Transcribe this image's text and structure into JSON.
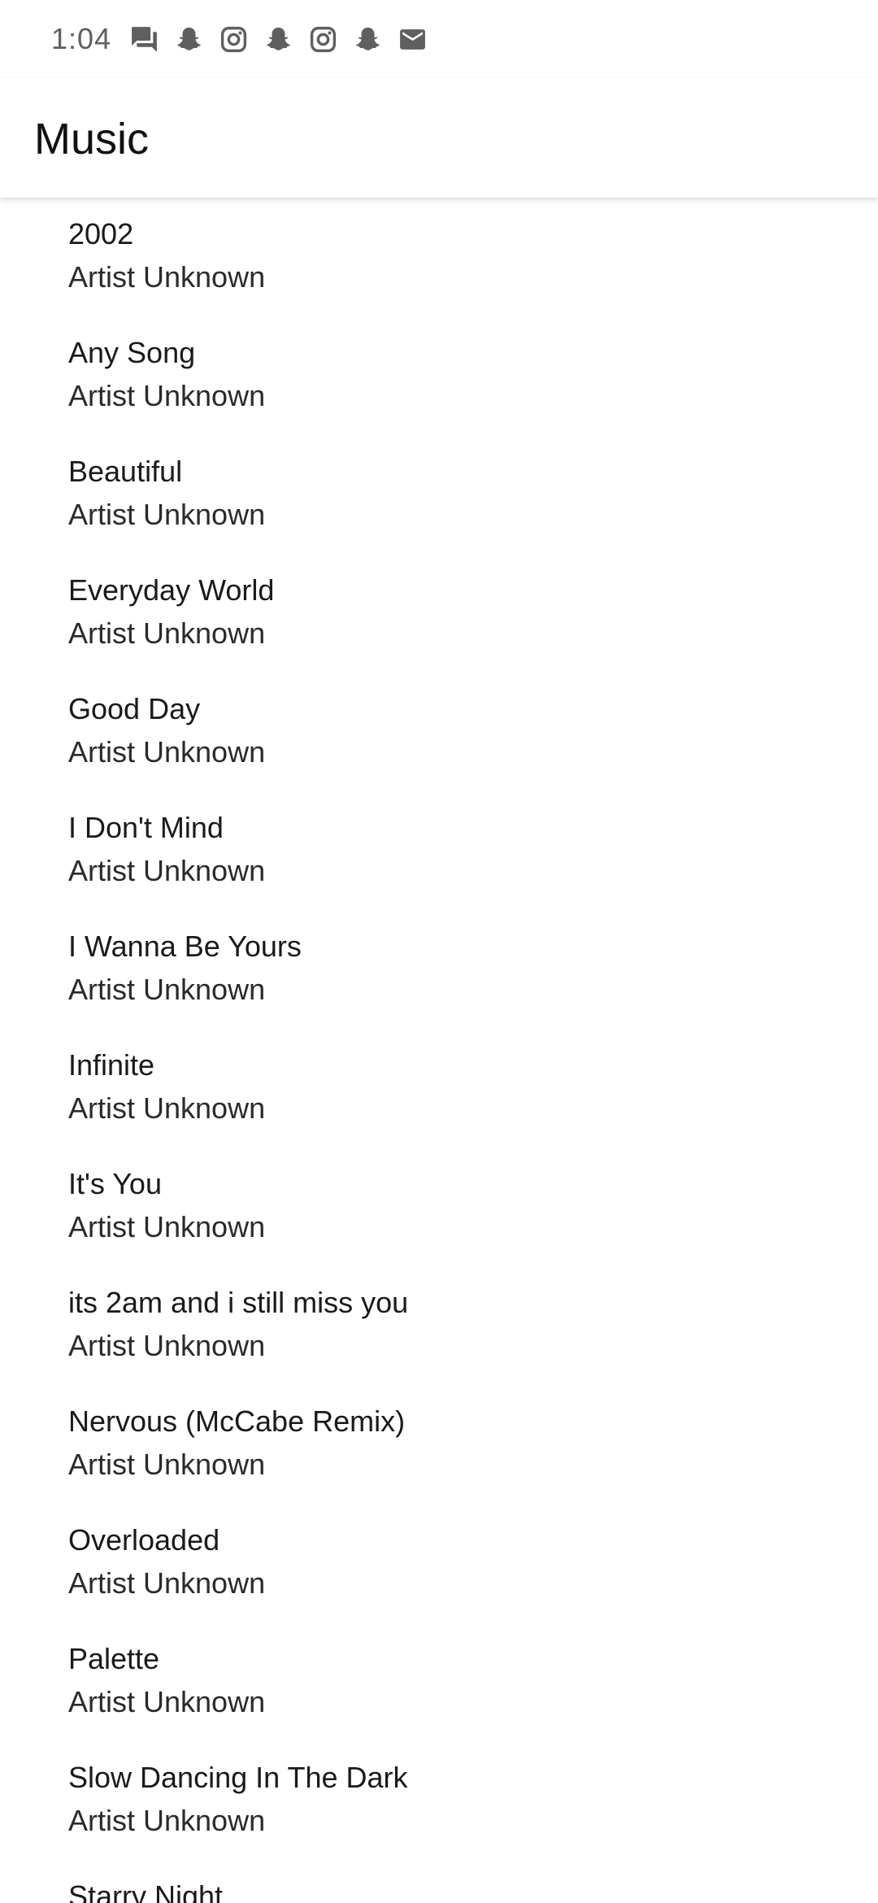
{
  "status_bar": {
    "time": "1:04",
    "icons": [
      "chat-icon",
      "snapchat-icon",
      "instagram-icon",
      "snapchat-icon",
      "instagram-icon",
      "snapchat-icon",
      "gmail-icon"
    ]
  },
  "app_bar": {
    "title": "Music"
  },
  "songs": [
    {
      "title": "2002",
      "artist": "Artist Unknown"
    },
    {
      "title": "Any Song",
      "artist": "Artist Unknown"
    },
    {
      "title": "Beautiful",
      "artist": "Artist Unknown"
    },
    {
      "title": "Everyday World",
      "artist": "Artist Unknown"
    },
    {
      "title": "Good Day",
      "artist": "Artist Unknown"
    },
    {
      "title": "I Don't Mind",
      "artist": "Artist Unknown"
    },
    {
      "title": "I Wanna Be Yours",
      "artist": "Artist Unknown"
    },
    {
      "title": "Infinite",
      "artist": "Artist Unknown"
    },
    {
      "title": "It's You",
      "artist": "Artist Unknown"
    },
    {
      "title": "its 2am and i still miss you",
      "artist": "Artist Unknown"
    },
    {
      "title": "Nervous (McCabe Remix)",
      "artist": "Artist Unknown"
    },
    {
      "title": "Overloaded",
      "artist": "Artist Unknown"
    },
    {
      "title": "Palette",
      "artist": "Artist Unknown"
    },
    {
      "title": "Slow Dancing In The Dark",
      "artist": "Artist Unknown"
    },
    {
      "title": "Starry Night",
      "artist": ""
    }
  ]
}
